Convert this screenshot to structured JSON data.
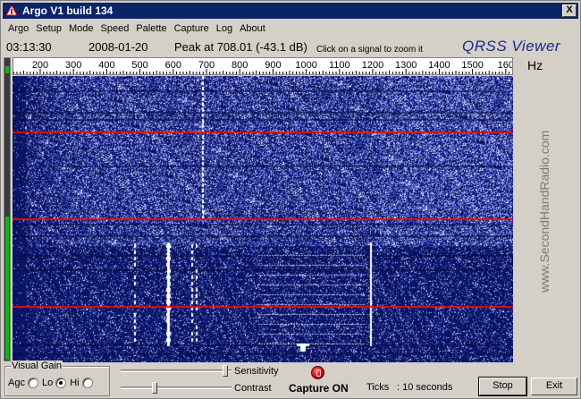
{
  "window": {
    "title": "Argo V1 build 134",
    "close_label": "X"
  },
  "menu": {
    "items": [
      "Argo",
      "Setup",
      "Mode",
      "Speed",
      "Palette",
      "Capture",
      "Log",
      "About"
    ]
  },
  "info": {
    "time": "03:13:30",
    "date": "2008-01-20",
    "peak": "Peak at 708.01 (-43.1 dB)",
    "hint": "Click on a signal to zoom it",
    "brand": "QRSS Viewer"
  },
  "scale": {
    "labels": [
      "200",
      "300",
      "400",
      "500",
      "600",
      "700",
      "800",
      "900",
      "1000",
      "1100",
      "1200",
      "1300",
      "1400",
      "1500",
      "160"
    ],
    "unit": "Hz"
  },
  "watermark": "www.SecondHandRadio.com",
  "visual_gain": {
    "legend": "Visual Gain",
    "options": [
      "Agc",
      "Lo",
      "Hi"
    ],
    "selected": "Lo"
  },
  "sensitivity": {
    "label": "Sensitivity",
    "level": 0.97
  },
  "contrast": {
    "label": "Contrast",
    "level": 0.3
  },
  "capture": {
    "status": "Capture ON"
  },
  "ticks": {
    "label": "Ticks",
    "value": ": 10 seconds"
  },
  "buttons": {
    "stop": "Stop",
    "exit": "Exit"
  },
  "colors": {
    "titlebar": "#0a246a",
    "waterfall_bg": "#0a1060",
    "marker_line": "#e01010",
    "capture_led": "#d00000",
    "level_bar": "#00c000"
  }
}
